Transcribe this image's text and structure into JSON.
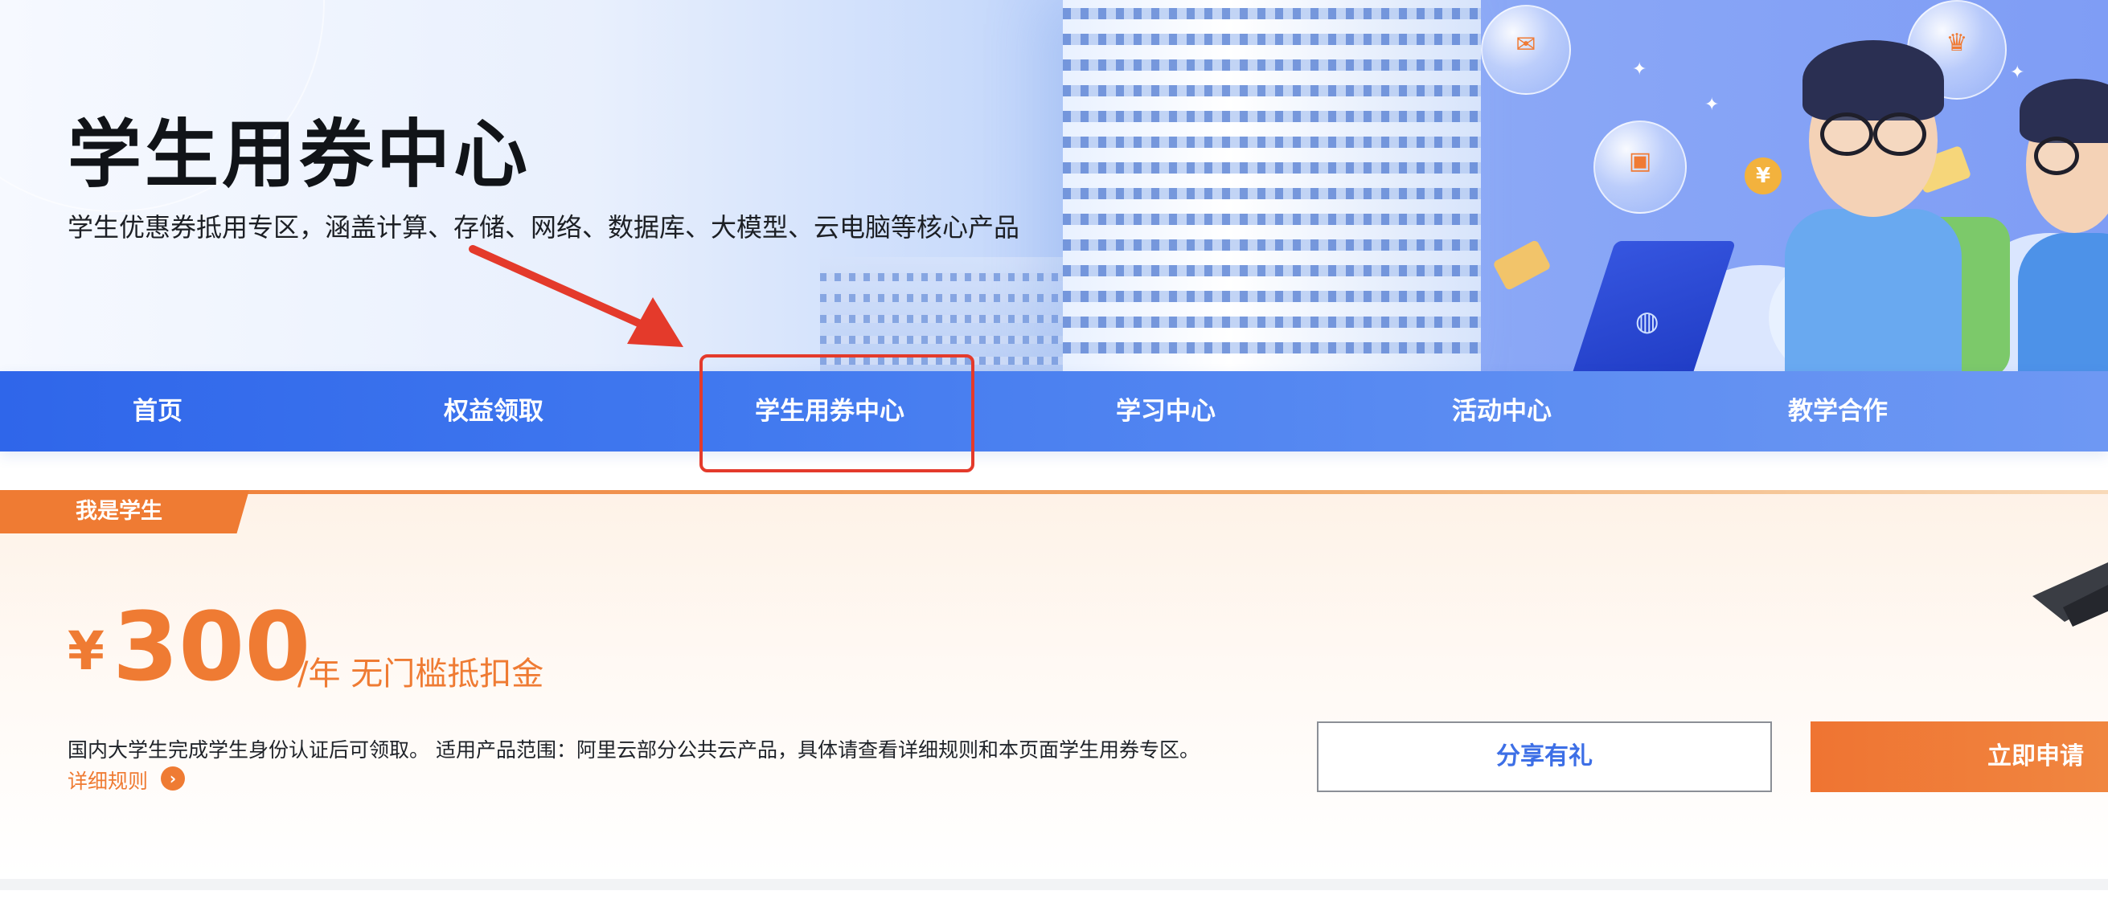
{
  "hero": {
    "title": "学生用券中心",
    "subtitle": "学生优惠券抵用专区，涵盖计算、存储、网络、数据库、大模型、云电脑等核心产品"
  },
  "nav": {
    "items": [
      {
        "label": "首页"
      },
      {
        "label": "权益领取"
      },
      {
        "label": "学生用券中心"
      },
      {
        "label": "学习中心"
      },
      {
        "label": "活动中心"
      },
      {
        "label": "教学合作"
      }
    ],
    "active_index": 2
  },
  "student_panel": {
    "tag": "我是学生",
    "currency": "¥",
    "amount": "300",
    "unit": "/年 无门槛抵扣金",
    "description": "国内大学生完成学生身份认证后可领取。 适用产品范围：阿里云部分公共云产品，具体请查看详细规则和本页面学生用券专区。",
    "rules_link": "详细规则",
    "share_button": "分享有礼",
    "apply_button": "立即申请"
  },
  "colors": {
    "brand_orange": "#ef7b33",
    "nav_blue": "#3b6fec",
    "annotation_red": "#e43a2b",
    "share_text_blue": "#3d6fe6"
  },
  "icons": [
    "arrow-right-circle-icon",
    "annotation-arrow",
    "mortarboard-icon",
    "laptop-logo-icon"
  ]
}
